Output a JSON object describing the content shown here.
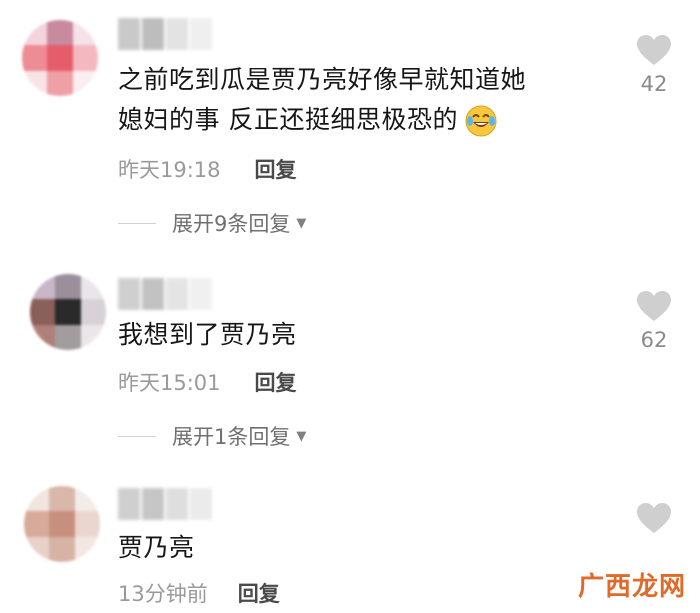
{
  "comments": [
    {
      "text_line1": "之前吃到瓜是贾乃亮好像早就知道她",
      "text_line2": "媳妇的事 反正还挺细思极恐的",
      "emoji": "laughing-crying-emoji",
      "time": "昨天19:18",
      "reply_label": "回复",
      "expand_label": "展开9条回复",
      "likes": "42",
      "avatar_colors": [
        "#f4d3dc",
        "#c98aa0",
        "#f6e2e8",
        "#ee8c95",
        "#e65c6a",
        "#f4b9c0",
        "#f8e4e6",
        "#ef9fa6",
        "#fbeef0"
      ],
      "name_colors": [
        "#c9c9c9",
        "#bdbdbd",
        "#e3e3e3",
        "#efefef"
      ]
    },
    {
      "text_line1": "我想到了贾乃亮",
      "time": "昨天15:01",
      "reply_label": "回复",
      "expand_label": "展开1条回复",
      "likes": "62",
      "avatar_colors": [
        "#c7b6c8",
        "#9a8f9a",
        "#e9e6ea",
        "#8b5f5a",
        "#2a2a2a",
        "#d8d2d8",
        "#b07f7a",
        "#a39c9e",
        "#eae7ea"
      ],
      "name_colors": [
        "#cfcfcf",
        "#c2c2c2",
        "#e4e4e4",
        "#f0f0f0"
      ]
    },
    {
      "text_line1": "贾乃亮",
      "time": "13分钟前",
      "reply_label": "回复",
      "avatar_colors": [
        "#f2e4df",
        "#d9b7aa",
        "#f4ece9",
        "#d7ab9a",
        "#c7907e",
        "#ead6cf",
        "#e9d1c8",
        "#d7b3a6",
        "#f3e7e3"
      ],
      "name_colors": [
        "#cfcfcf",
        "#c6c6c6",
        "#dedede",
        "#ebebeb"
      ]
    }
  ],
  "watermark": "广西龙网",
  "colors": {
    "like_icon": "#cfcfcf",
    "watermark": "#e06a2a"
  }
}
